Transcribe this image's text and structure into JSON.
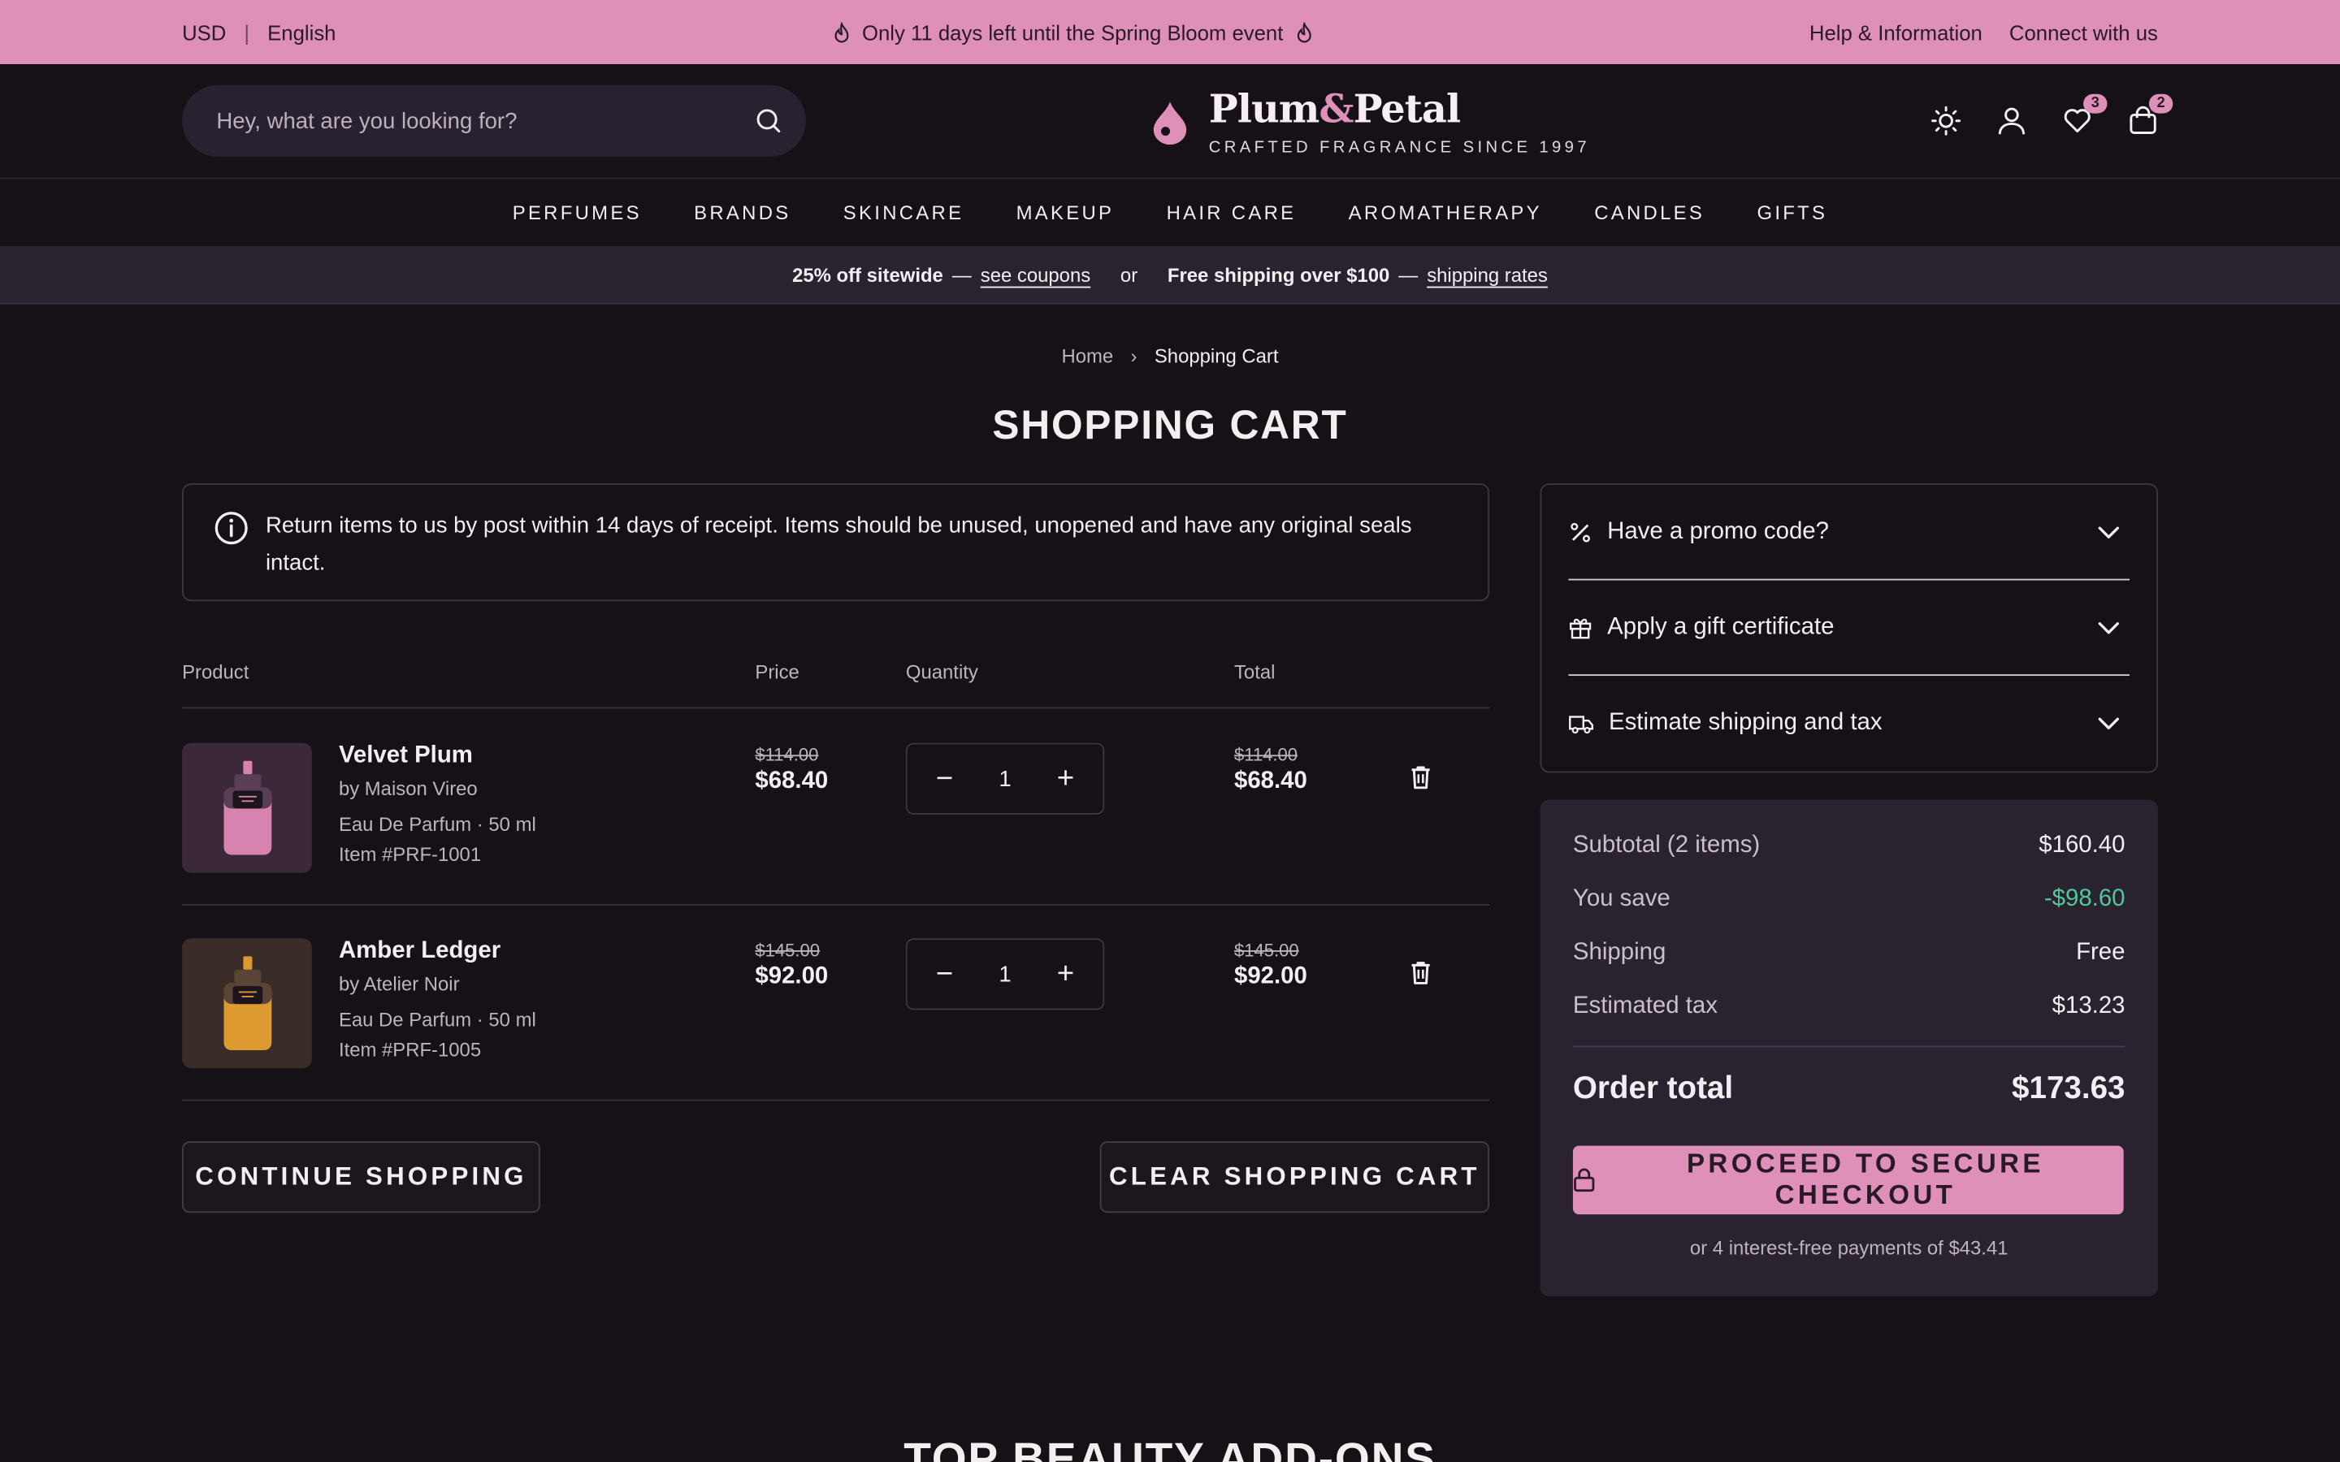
{
  "topbar": {
    "currency": "USD",
    "language": "English",
    "announcement": "Only 11 days left until the Spring Bloom event",
    "help_link": "Help & Information",
    "connect_link": "Connect with us"
  },
  "header": {
    "search_placeholder": "Hey, what are you looking for?",
    "logo_name_1": "Plum",
    "logo_amp": "&",
    "logo_name_2": "Petal",
    "logo_tagline": "CRAFTED FRAGRANCE SINCE 1997",
    "wishlist_count": "3",
    "cart_count": "2"
  },
  "nav": [
    "PERFUMES",
    "BRANDS",
    "SKINCARE",
    "MAKEUP",
    "HAIR CARE",
    "AROMATHERAPY",
    "CANDLES",
    "GIFTS"
  ],
  "promo_strip": {
    "offer_1": "25% off sitewide",
    "dash_1": "—",
    "link_1": "see coupons",
    "or": "or",
    "offer_2": "Free shipping over $100",
    "dash_2": "—",
    "link_2": "shipping rates"
  },
  "breadcrumb": {
    "home": "Home",
    "current": "Shopping Cart"
  },
  "page_title": "SHOPPING CART",
  "notice": "Return items to us by post within 14 days of receipt. Items should be unused, unopened and have any original seals intact.",
  "table": {
    "headers": {
      "product": "Product",
      "price": "Price",
      "quantity": "Quantity",
      "total": "Total"
    },
    "items": [
      {
        "name": "Velvet Plum",
        "brand": "by Maison Vireo",
        "desc": "Eau De Parfum · 50 ml",
        "sku": "Item #PRF-1001",
        "was": "$114.00",
        "price": "$68.40",
        "qty": "1",
        "total_was": "$114.00",
        "total": "$68.40",
        "bottle_color": "#d882b0",
        "thumb_bg": "#3b2838"
      },
      {
        "name": "Amber Ledger",
        "brand": "by Atelier Noir",
        "desc": "Eau De Parfum · 50 ml",
        "sku": "Item #PRF-1005",
        "was": "$145.00",
        "price": "$92.00",
        "qty": "1",
        "total_was": "$145.00",
        "total": "$92.00",
        "bottle_color": "#dc9a30",
        "thumb_bg": "#3a2c26"
      }
    ]
  },
  "buttons": {
    "continue": "CONTINUE SHOPPING",
    "clear": "CLEAR SHOPPING CART"
  },
  "accordion": {
    "promo": "Have a promo code?",
    "gift": "Apply a gift certificate",
    "shipping": "Estimate shipping and tax"
  },
  "summary": {
    "subtotal_label": "Subtotal (2 items)",
    "subtotal": "$160.40",
    "save_label": "You save",
    "save": "-$98.60",
    "shipping_label": "Shipping",
    "shipping": "Free",
    "tax_label": "Estimated tax",
    "tax": "$13.23",
    "total_label": "Order total",
    "total": "$173.63",
    "checkout": "PROCEED TO SECURE CHECKOUT",
    "installments": "or 4 interest-free payments of $43.41"
  },
  "addons_heading": "TOP BEAUTY ADD-ONS",
  "colors": {
    "accent": "#df90b9",
    "background": "#161017",
    "panel": "#2b2230",
    "savings": "#4fc79a"
  }
}
